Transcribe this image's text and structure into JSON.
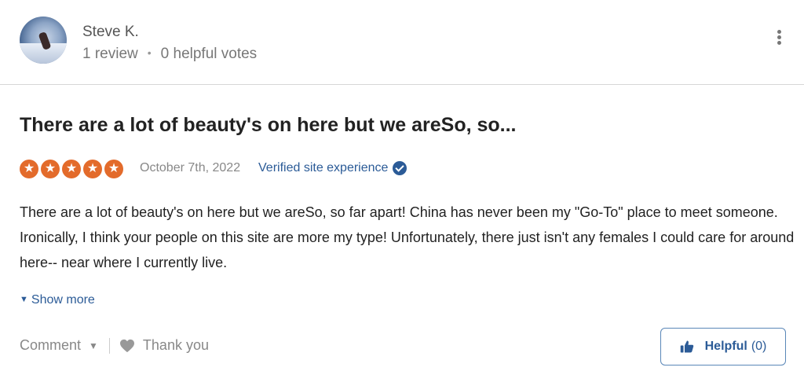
{
  "reviewer": {
    "name": "Steve K.",
    "review_count": "1 review",
    "separator": "•",
    "helpful_votes": "0 helpful votes"
  },
  "review": {
    "title": "There are a lot of beauty's on here but we areSo, so...",
    "rating": 5,
    "rating_max": 5,
    "date": "October 7th, 2022",
    "verified_label": "Verified site experience",
    "body": "There are a lot of beauty's on here but we areSo, so far apart! China has never been my \"Go-To\" place to meet someone. Ironically, I think your people on this site are more my type! Unfortunately, there just isn't any females I could care for around here-- near where I currently live.",
    "show_more": "Show more"
  },
  "footer": {
    "comment_label": "Comment",
    "thank_you_label": "Thank you",
    "helpful_label": "Helpful",
    "helpful_count": "(0)"
  },
  "colors": {
    "star": "#e36b2b",
    "link": "#2b5b97",
    "muted": "#888888"
  },
  "icons": {
    "menu": "kebab-menu-icon",
    "verified": "verified-check-icon",
    "heart": "heart-icon",
    "thumb": "thumbs-up-icon"
  }
}
